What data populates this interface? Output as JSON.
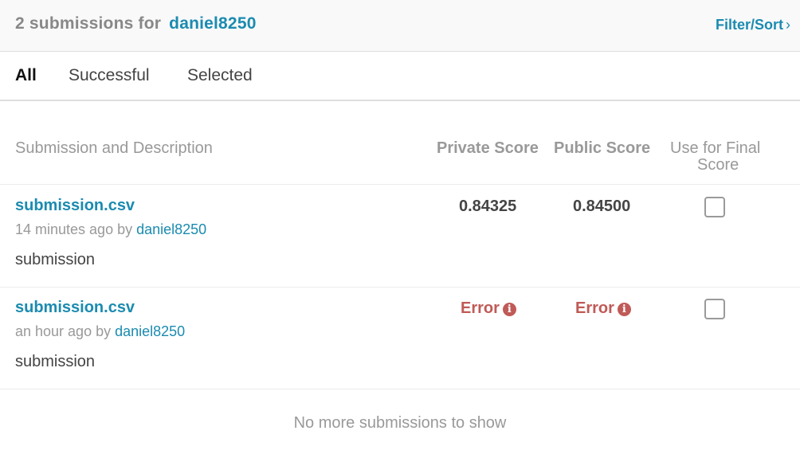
{
  "header": {
    "count_text": "2 submissions for",
    "username": "daniel8250",
    "filter_label": "Filter/Sort",
    "filter_chevron": "›"
  },
  "tabs": [
    {
      "label": "All",
      "active": true
    },
    {
      "label": "Successful",
      "active": false
    },
    {
      "label": "Selected",
      "active": false
    }
  ],
  "table": {
    "columns": {
      "submission": "Submission and Description",
      "private": "Private Score",
      "public": "Public Score",
      "final_line1": "Use for Final",
      "final_line2": "Score"
    },
    "rows": [
      {
        "filename": "submission.csv",
        "time": "14 minutes ago by",
        "user": "daniel8250",
        "description": "submission",
        "private_score": "0.84325",
        "public_score": "0.84500",
        "selected": false
      },
      {
        "filename": "submission.csv",
        "time": "an hour ago by",
        "user": "daniel8250",
        "description": "submission",
        "private_score": "Error",
        "public_score": "Error",
        "selected": false
      }
    ]
  },
  "footer_text": "No more submissions to show",
  "colors": {
    "accent": "#1b8bb0",
    "error": "#c05a56"
  },
  "icons": {
    "error_info": "info-icon",
    "filter": "chevron-right-icon"
  }
}
